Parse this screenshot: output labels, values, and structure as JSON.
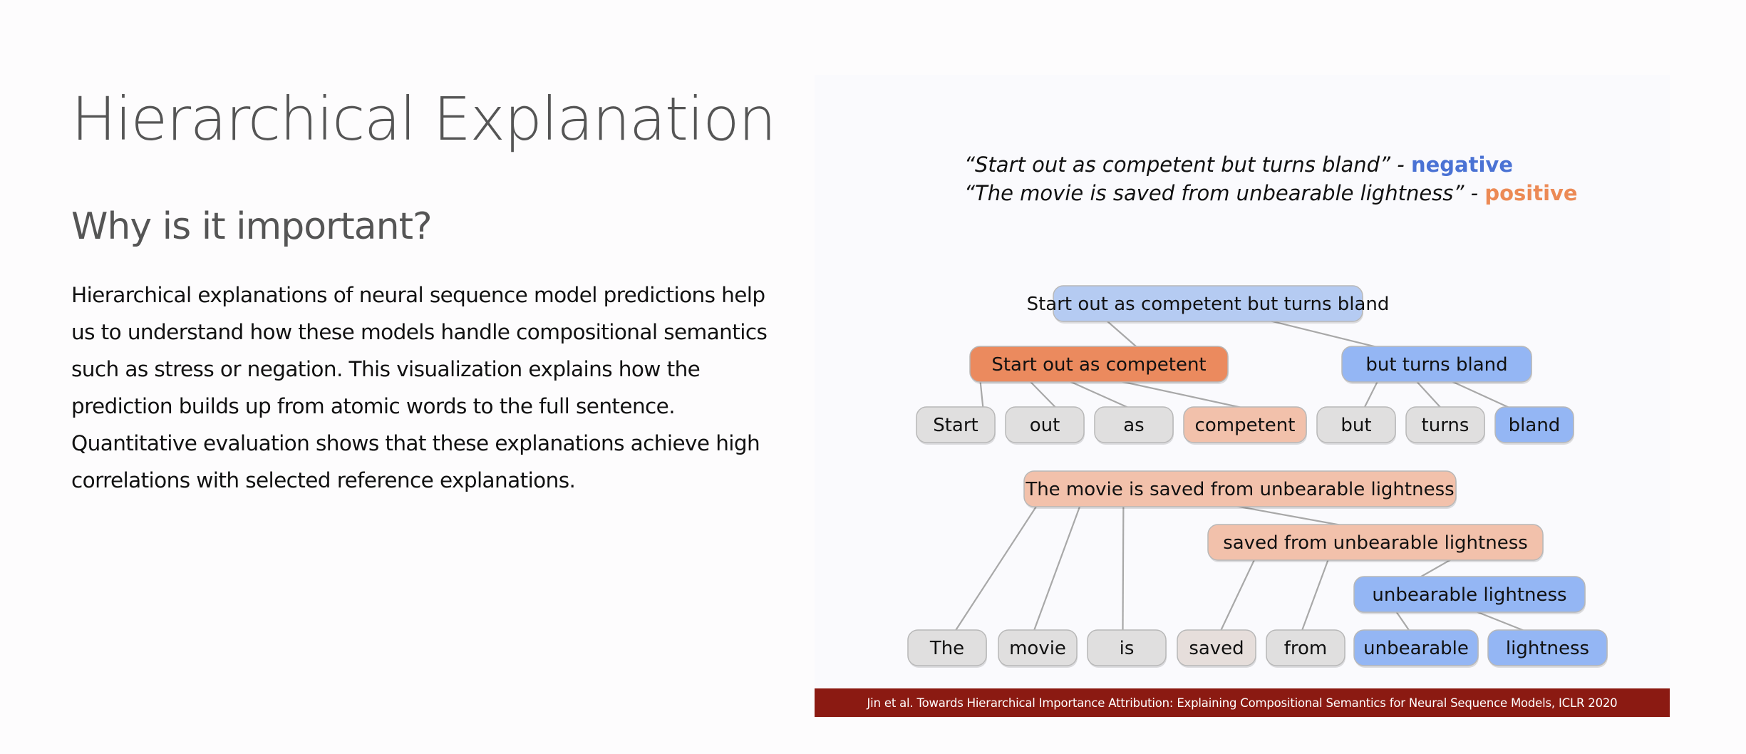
{
  "slide": {
    "title": "Hierarchical Explanation",
    "heading": "Why is it important?",
    "body": "Hierarchical explanations of neural sequence model predictions help us to understand how these models handle compositional semantics such as stress or negation. This visualization explains how the prediction builds up from atomic words to the full sentence. Quantitative evaluation shows that these explanations achieve high correlations with selected reference explanations."
  },
  "figure": {
    "quotes": [
      {
        "text": "“Start out as competent but turns bland” -",
        "label": "negative",
        "label_color": "#4a72d4"
      },
      {
        "text": "“The movie is saved from unbearable lightness” -",
        "label": "positive",
        "label_color": "#ec8a55"
      }
    ],
    "colors": {
      "light_blue": "#b5cbf2",
      "blue": "#94b6f4",
      "orange": "#eb8a5e",
      "peach": "#f2c1ab",
      "gray": "#e0dfdf",
      "gray_warm": "#e6dedb",
      "edge": "#a8a8a8"
    },
    "trees": [
      {
        "nodes": [
          {
            "id": "t1_root",
            "text": "Start out as competent but turns bland",
            "color": "#b5cbf2"
          },
          {
            "id": "t1_left",
            "text": "Start out as competent",
            "color": "#eb8a5e"
          },
          {
            "id": "t1_right",
            "text": "but turns bland",
            "color": "#94b6f4"
          },
          {
            "id": "t1_w1",
            "text": "Start",
            "color": "#e0dfdf"
          },
          {
            "id": "t1_w2",
            "text": "out",
            "color": "#e0dfdf"
          },
          {
            "id": "t1_w3",
            "text": "as",
            "color": "#e0dfdf"
          },
          {
            "id": "t1_w4",
            "text": "competent",
            "color": "#f2c1ab"
          },
          {
            "id": "t1_w5",
            "text": "but",
            "color": "#e0dfdf"
          },
          {
            "id": "t1_w6",
            "text": "turns",
            "color": "#e0dfdf"
          },
          {
            "id": "t1_w7",
            "text": "bland",
            "color": "#94b6f4"
          }
        ],
        "edges": [
          [
            "t1_root",
            "t1_left"
          ],
          [
            "t1_root",
            "t1_right"
          ],
          [
            "t1_left",
            "t1_w1"
          ],
          [
            "t1_left",
            "t1_w2"
          ],
          [
            "t1_left",
            "t1_w3"
          ],
          [
            "t1_left",
            "t1_w4"
          ],
          [
            "t1_right",
            "t1_w5"
          ],
          [
            "t1_right",
            "t1_w6"
          ],
          [
            "t1_right",
            "t1_w7"
          ]
        ]
      },
      {
        "nodes": [
          {
            "id": "t2_root",
            "text": "The movie is saved from unbearable lightness",
            "color": "#f2c1ab"
          },
          {
            "id": "t2_mid",
            "text": "saved from unbearable lightness",
            "color": "#f2c1ab"
          },
          {
            "id": "t2_low",
            "text": "unbearable lightness",
            "color": "#94b6f4"
          },
          {
            "id": "t2_w1",
            "text": "The",
            "color": "#e0dfdf"
          },
          {
            "id": "t2_w2",
            "text": "movie",
            "color": "#e0dfdf"
          },
          {
            "id": "t2_w3",
            "text": "is",
            "color": "#e0dfdf"
          },
          {
            "id": "t2_w4",
            "text": "saved",
            "color": "#e6dedb"
          },
          {
            "id": "t2_w5",
            "text": "from",
            "color": "#e0dfdf"
          },
          {
            "id": "t2_w6",
            "text": "unbearable",
            "color": "#94b6f4"
          },
          {
            "id": "t2_w7",
            "text": "lightness",
            "color": "#94b6f4"
          }
        ],
        "edges": [
          [
            "t2_root",
            "t2_w1"
          ],
          [
            "t2_root",
            "t2_w2"
          ],
          [
            "t2_root",
            "t2_w3"
          ],
          [
            "t2_root",
            "t2_mid"
          ],
          [
            "t2_mid",
            "t2_w4"
          ],
          [
            "t2_mid",
            "t2_w5"
          ],
          [
            "t2_mid",
            "t2_low"
          ],
          [
            "t2_low",
            "t2_w6"
          ],
          [
            "t2_low",
            "t2_w7"
          ]
        ]
      }
    ],
    "citation": "Jin et al. Towards Hierarchical Importance Attribution: Explaining Compositional Semantics for Neural Sequence Models, ICLR 2020"
  }
}
